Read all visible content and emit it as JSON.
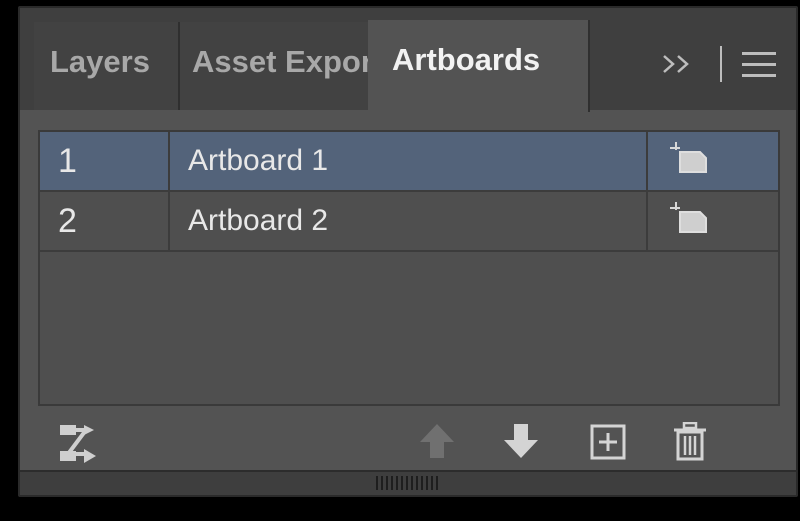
{
  "tabs": [
    {
      "label": "Layers"
    },
    {
      "label": "Asset Export"
    },
    {
      "label": "Artboards"
    }
  ],
  "tab_overflow_label": "»",
  "artboards": [
    {
      "number": "1",
      "name": "Artboard 1",
      "selected": true
    },
    {
      "number": "2",
      "name": "Artboard 2",
      "selected": false
    }
  ],
  "footer_icons": [
    "rearrange-icon",
    "move-up-icon",
    "move-down-icon",
    "new-artboard-icon",
    "delete-icon"
  ],
  "colors": {
    "panel_bg": "#535353",
    "selected_row": "#53637a",
    "text": "#e8e8e8"
  }
}
